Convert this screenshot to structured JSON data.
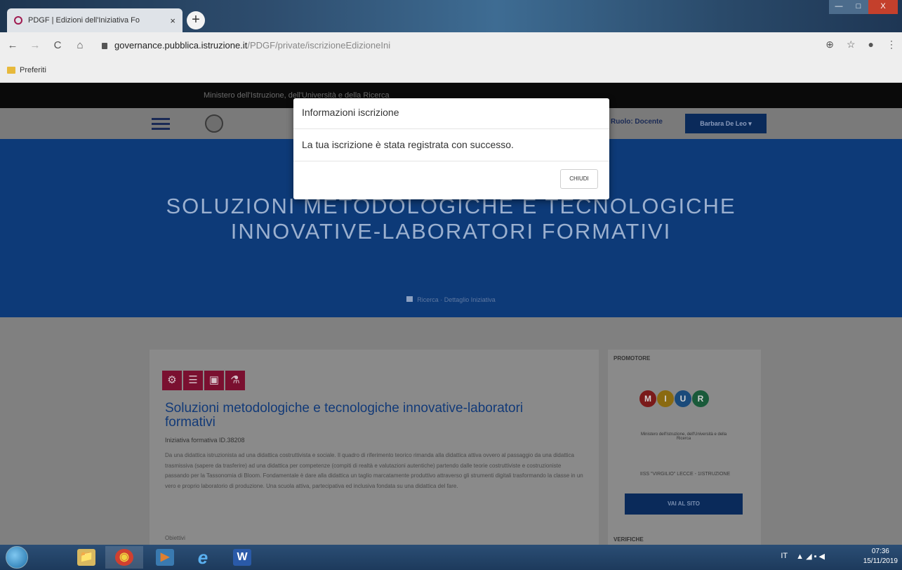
{
  "browser": {
    "tab_title": "PDGF | Edizioni dell'Iniziativa Fo",
    "tab_close": "×",
    "new_tab": "+",
    "url_host": "governance.pubblica.istruzione.it",
    "url_path": "/PDGF/private/iscrizioneEdizioneIni",
    "bookmark_label": "Preferiti",
    "window_controls": {
      "minimize": "—",
      "maximize": "□",
      "close": "X"
    },
    "nav": {
      "back": "←",
      "forward": "→",
      "reload": "C",
      "home": "⌂"
    },
    "right": {
      "zoom": "⊕",
      "star": "☆",
      "account": "●",
      "menu": "⋮"
    }
  },
  "page": {
    "ministry": "Ministero dell'Istruzione, dell'Università e della Ricerca",
    "role_link": "Ruolo: Docente",
    "user_button": "Barbara De Leo ▾",
    "hero_title": "SOLUZIONI METODOLOGICHE E TECNOLOGICHE INNOVATIVE-LABORATORI FORMATIVI",
    "breadcrumb": "Ricerca · Dettaglio Iniziativa",
    "card": {
      "icons": [
        "⚙",
        "☰",
        "▣",
        "⚗"
      ],
      "title": "Soluzioni metodologiche e tecnologiche innovative-laboratori formativi",
      "id": "Iniziativa formativa ID.38208",
      "text": "Da una didattica istruzionista ad una didattica costruttivista e sociale. Il quadro di riferimento teorico rimanda alla didattica attiva ovvero al passaggio da una didattica trasmissiva (sapere da trasferire) ad una didattica per competenze (compiti di realtà e valutazioni autentiche) partendo dalle teorie costruttiviste e costruzioniste passando per la Tassonomia di Bloom. Fondamentale è dare alla didattica un taglio marcatamente produttivo attraverso gli strumenti digitali trasformando la classe in un vero e proprio laboratorio di produzione. Una scuola attiva, partecipativa ed inclusiva fondata su una didattica del fare.",
      "more": "Obiettivi"
    },
    "sidebar": {
      "heading": "PROMOTORE",
      "logo_letters": [
        "M",
        "I",
        "U",
        "R"
      ],
      "logo_sub": "Ministero dell'Istruzione, dell'Università e della Ricerca",
      "promoter": "IISS \"VIRGILIO\" LECCE - 1ISTRUZIONE",
      "site_button": "VAI AL SITO",
      "heading2": "VERIFICHE"
    }
  },
  "modal": {
    "title": "Informazioni iscrizione",
    "message": "La tua iscrizione è stata registrata con successo.",
    "close_button": "CHIUDI"
  },
  "taskbar": {
    "apps": [
      "📁",
      "◉",
      "▶",
      "e",
      "W"
    ],
    "language": "IT",
    "tray_icons": "▲ ◢ ▪ ◀",
    "time": "07:36",
    "date": "15/11/2019"
  },
  "colors": {
    "hero_blue": "#0d3a78",
    "accent_navy": "#0a2a5a",
    "icon_maroon": "#7a1030"
  }
}
